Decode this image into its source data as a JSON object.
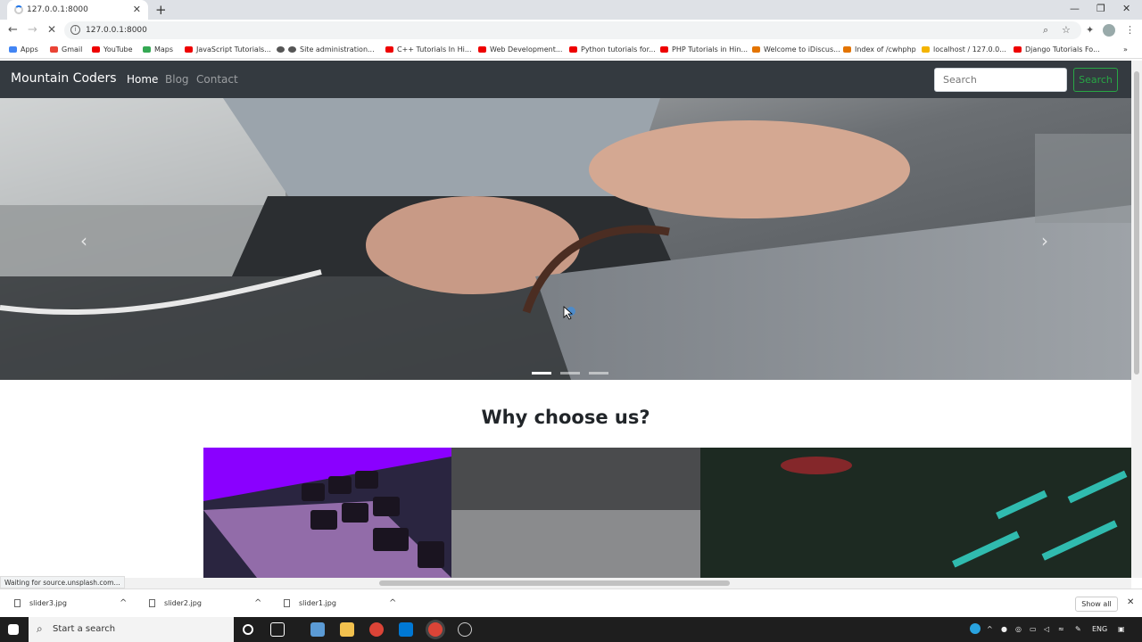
{
  "browser": {
    "tab_title": "127.0.0.1:8000",
    "tab_close": "✕",
    "new_tab": "+",
    "url": "127.0.0.1:8000",
    "bookmarks": [
      "Apps",
      "Gmail",
      "YouTube",
      "Maps",
      "JavaScript Tutorials...",
      "Site administration...",
      "C++ Tutorials In Hi...",
      "Web Development...",
      "Python tutorials for...",
      "PHP Tutorials in Hin...",
      "Welcome to iDiscus...",
      "Index of /cwhphp",
      "localhost / 127.0.0...",
      "Django Tutorials Fo..."
    ],
    "status_text": "Waiting for source.unsplash.com..."
  },
  "site": {
    "brand": "Mountain Coders",
    "nav": [
      "Home",
      "Blog",
      "Contact"
    ],
    "active_nav": "Home",
    "search_placeholder": "Search",
    "search_button": "Search",
    "section_title": "Why choose us?",
    "carousel_slide_count": 3,
    "carousel_active_slide": 1,
    "prev_control": "‹",
    "next_control": "›"
  },
  "downloads": {
    "files": [
      "slider3.jpg",
      "slider2.jpg",
      "slider1.jpg"
    ],
    "show_all": "Show all",
    "close": "✕"
  },
  "taskbar": {
    "search_placeholder": "Start a search",
    "language": "ENG"
  },
  "colors": {
    "navbar": "#343a40",
    "search_button": "#28a745",
    "card_purple": "#8a00ff"
  }
}
